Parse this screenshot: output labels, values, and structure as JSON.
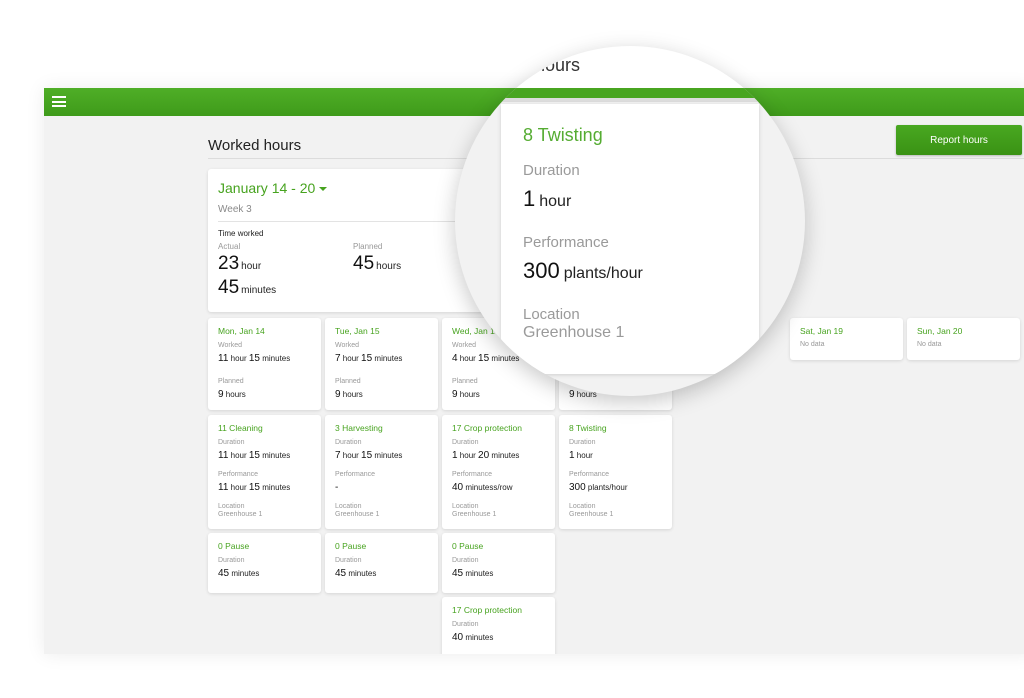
{
  "header": {
    "menu_icon": "hamburger-menu-icon",
    "brand_color": "#46a31e"
  },
  "page": {
    "title": "Worked hours",
    "report_button": "Report hours"
  },
  "summary": {
    "week_range": "January 14 - 20",
    "week_label": "Week 3",
    "time_worked_label": "Time worked",
    "actual_label": "Actual",
    "actual_hours": "23",
    "actual_hours_unit": "hour",
    "actual_minutes": "45",
    "actual_minutes_unit": "minutes",
    "planned_label": "Planned",
    "planned_hours": "45",
    "planned_hours_unit": "hours"
  },
  "days": [
    {
      "title": "Mon, Jan 14",
      "worked_label": "Worked",
      "worked_h": "11",
      "worked_h_unit": "hour",
      "worked_m": "15",
      "worked_m_unit": "minutes",
      "planned_label": "Planned",
      "planned_h": "9",
      "planned_unit": "hours"
    },
    {
      "title": "Tue, Jan 15",
      "worked_label": "Worked",
      "worked_h": "7",
      "worked_h_unit": "hour",
      "worked_m": "15",
      "worked_m_unit": "minutes",
      "planned_label": "Planned",
      "planned_h": "9",
      "planned_unit": "hours"
    },
    {
      "title": "Wed, Jan 1",
      "worked_label": "Worked",
      "worked_h": "4",
      "worked_h_unit": "hour",
      "worked_m": "15",
      "worked_m_unit": "minutes",
      "planned_label": "Planned",
      "planned_h": "9",
      "planned_unit": "hours"
    },
    {
      "planned_h": "9",
      "planned_unit": "hours"
    },
    {
      "title": "Sat, Jan 19",
      "no_data": "No data"
    },
    {
      "title": "Sun, Jan 20",
      "no_data": "No data"
    }
  ],
  "tasks": [
    {
      "title": "11 Cleaning",
      "duration_label": "Duration",
      "d_h": "11",
      "d_h_unit": "hour",
      "d_m": "15",
      "d_m_unit": "minutes",
      "performance_label": "Performance",
      "p_num": "11",
      "p_unit": "hour",
      "p_num2": "15",
      "p_unit2": "minutes",
      "location_label": "Location",
      "location": "Greenhouse 1"
    },
    {
      "title": "3 Harvesting",
      "duration_label": "Duration",
      "d_h": "7",
      "d_h_unit": "hour",
      "d_m": "15",
      "d_m_unit": "minutes",
      "performance_label": "Performance",
      "p_num": "-",
      "location_label": "Location",
      "location": "Greenhouse 1"
    },
    {
      "title": "17 Crop protection",
      "duration_label": "Duration",
      "d_h": "1",
      "d_h_unit": "hour",
      "d_m": "20",
      "d_m_unit": "minutes",
      "performance_label": "Performance",
      "p_num": "40",
      "p_unit": "minutess/row",
      "location_label": "Location",
      "location": "Greenhouse 1"
    },
    {
      "title": "8 Twisting",
      "duration_label": "Duration",
      "d_h": "1",
      "d_h_unit": "hour",
      "performance_label": "Performance",
      "p_num": "300",
      "p_unit": "plants/hour",
      "location_label": "Location",
      "location": "Greenhouse 1"
    }
  ],
  "pauses": [
    {
      "title": "0 Pause",
      "duration_label": "Duration",
      "d_m": "45",
      "d_m_unit": "minutes"
    },
    {
      "title": "0 Pause",
      "duration_label": "Duration",
      "d_m": "45",
      "d_m_unit": "minutes"
    },
    {
      "title": "0 Pause",
      "duration_label": "Duration",
      "d_m": "45",
      "d_m_unit": "minutes"
    }
  ],
  "extra_task": {
    "title": "17 Crop protection",
    "duration_label": "Duration",
    "d_m": "40",
    "d_m_unit": "minutes"
  },
  "magnifier": {
    "header_fragment": "hours",
    "title": "8 Twisting",
    "duration_label": "Duration",
    "duration_num": "1",
    "duration_unit": "hour",
    "performance_label": "Performance",
    "performance_num": "300",
    "performance_unit": "plants/hour",
    "location_label": "Location",
    "location": "Greenhouse 1"
  }
}
